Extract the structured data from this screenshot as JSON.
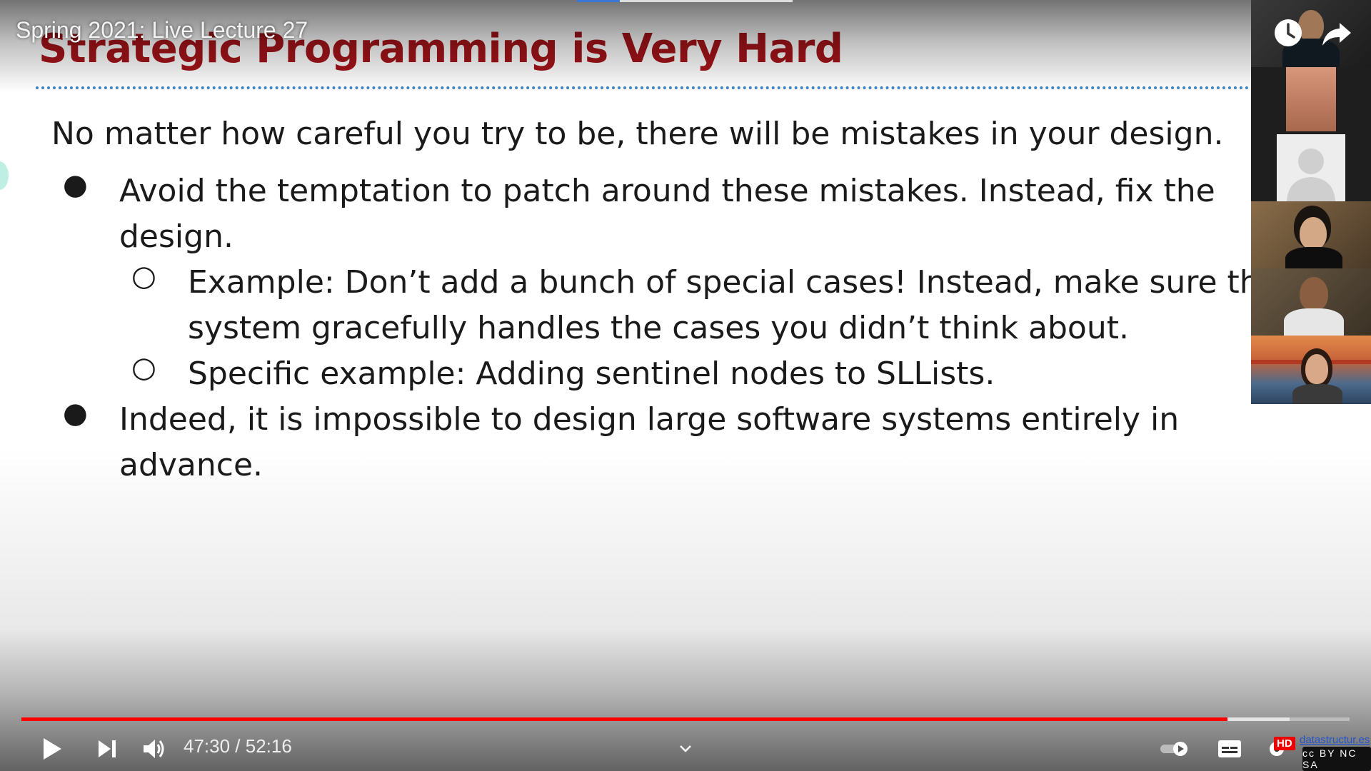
{
  "video": {
    "title": "Spring 2021: Live Lecture 27"
  },
  "slide": {
    "title": "Strategic Programming is Very Hard",
    "intro": "No matter how careful you try to be, there will be mistakes in your design.",
    "bullet1_line1": "Avoid the temptation to patch around these mistakes. Instead, fix the",
    "bullet1_line2": "design.",
    "sub1_line1": "Example: Don’t add a bunch of special cases! Instead, make sure the",
    "sub1_line2": "system gracefully handles the cases you didn’t think about.",
    "sub2_line1": "Specific example: Adding sentinel nodes to SLLists.",
    "bullet2_line1": "Indeed, it is impossible to design large software systems entirely in",
    "bullet2_line2": "advance.",
    "bullet_glyph": "●",
    "sub_bullet_glyph": "○"
  },
  "controls": {
    "time_current": "47:30",
    "time_sep": " / ",
    "time_total": "52:16",
    "progress_played": 0.908,
    "progress_buffered": 0.955,
    "hd_label": "HD",
    "watermark_text": "datastructur.es",
    "cc_text": "cc BY NC SA"
  },
  "colors": {
    "title": "#a4141a",
    "rule": "#3c84c4",
    "progress": "#ff0000"
  }
}
